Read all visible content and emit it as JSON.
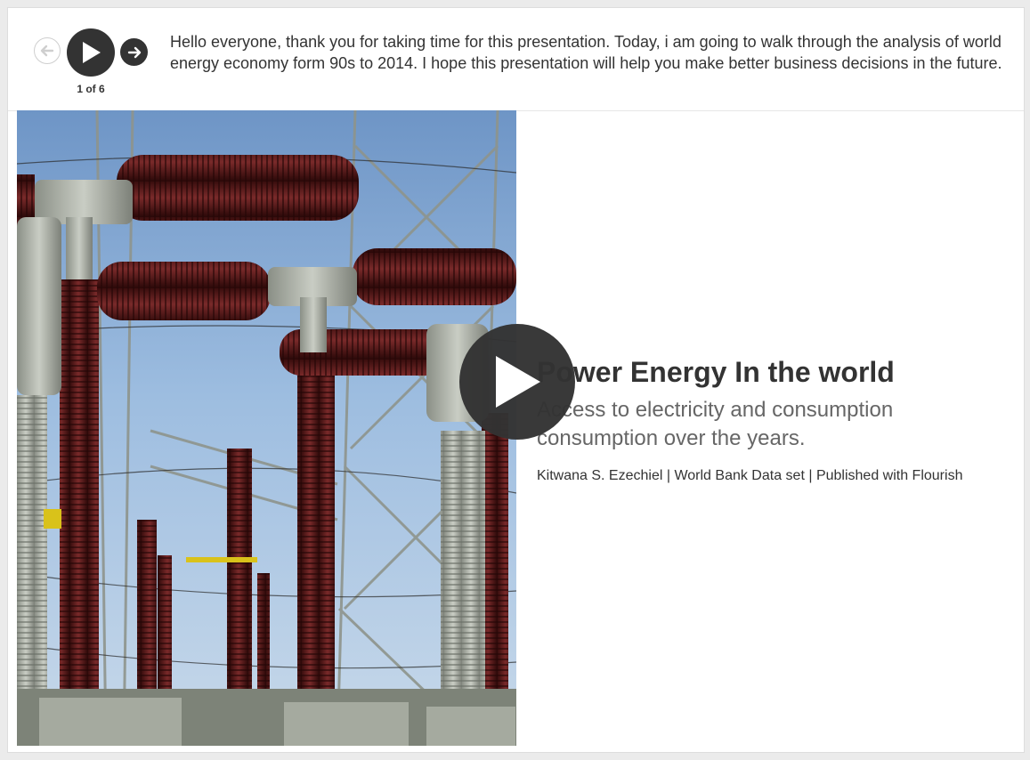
{
  "controls": {
    "prev_icon": "arrow-left-icon",
    "play_icon": "play-icon",
    "next_icon": "arrow-right-icon",
    "counter": "1 of 6"
  },
  "caption": "Hello everyone, thank you for taking time for this presentation. Today, i am going to walk through the analysis of world energy economy form 90s to 2014. I hope this presentation will help you make better business decisions in the future.",
  "slide": {
    "title": "Power Energy In the world",
    "subtitle": "Access to electricity and consumption consumption over the years.",
    "credit": "Kitwana S. Ezechiel | World Bank Data set | Published with Flourish"
  },
  "colors": {
    "dark": "#333333",
    "muted": "#666666",
    "insulator": "#5a1a1a",
    "sky": "#8fb0d8"
  }
}
